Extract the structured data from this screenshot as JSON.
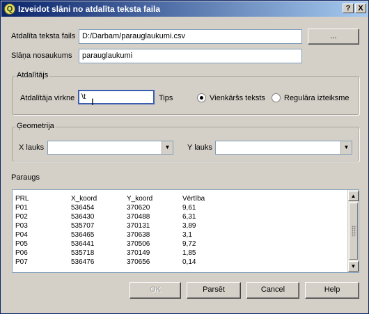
{
  "window": {
    "title": "Izveidot slāni no atdalīta teksta faila",
    "icon_letter": "Q",
    "help_button": "?",
    "close_button": "X"
  },
  "file": {
    "label": "Atdalīta teksta fails",
    "value": "D:/Darbam/parauglaukumi.csv",
    "browse_label": "..."
  },
  "layer": {
    "label": "Slāņa nosaukums",
    "value": "parauglaukumi"
  },
  "delimiter": {
    "group_title": "Atdalītājs",
    "label": "Atdalītāja virkne",
    "value": "\\t",
    "type_label": "Tips",
    "option_plain": "Vienkāršs teksts",
    "option_regex": "Regulāra izteiksme",
    "selected": "plain"
  },
  "geometry": {
    "group_title": "Ģeometrija",
    "x_label": "X lauks",
    "x_value": "",
    "y_label": "Y lauks",
    "y_value": ""
  },
  "sample": {
    "label": "Paraugs",
    "columns": [
      "PRL",
      "X_koord",
      "Y_koord",
      "Vērtība"
    ],
    "rows": [
      [
        "P01",
        "536454",
        "370620",
        "9,61"
      ],
      [
        "P02",
        "536430",
        "370488",
        "6,31"
      ],
      [
        "P03",
        "535707",
        "370131",
        "3,89"
      ],
      [
        "P04",
        "536465",
        "370638",
        "3,1"
      ],
      [
        "P05",
        "536441",
        "370506",
        "9,72"
      ],
      [
        "P06",
        "535718",
        "370149",
        "1,85"
      ],
      [
        "P07",
        "536476",
        "370656",
        "0,14"
      ]
    ]
  },
  "buttons": {
    "ok": "OK",
    "parse": "Parsēt",
    "cancel": "Cancel",
    "help": "Help"
  }
}
